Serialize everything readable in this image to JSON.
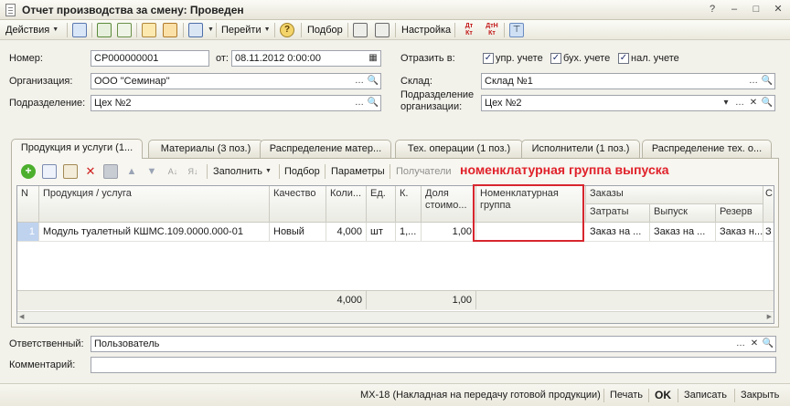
{
  "window": {
    "title": "Отчет производства за смену: Проведен"
  },
  "toolbar": {
    "actions": "Действия",
    "goto": "Перейти",
    "selection": "Подбор",
    "settings": "Настройка",
    "dt_kt": "Дт Кт",
    "dtn_kt": "ДтН Кт"
  },
  "form": {
    "number_label": "Номер:",
    "number": "СР000000001",
    "date_label": "от:",
    "date": "08.11.2012  0:00:00",
    "org_label": "Организация:",
    "org": "ООО \"Семинар\"",
    "dept_label": "Подразделение:",
    "dept": "Цех №2",
    "reflect_label": "Отразить в:",
    "check_mgmt": "упр. учете",
    "check_acc": "бух. учете",
    "check_tax": "нал. учете",
    "warehouse_label": "Склад:",
    "warehouse": "Склад №1",
    "org_dept_label_1": "Подразделение",
    "org_dept_label_2": "организации:",
    "org_dept": "Цех №2",
    "responsible_label": "Ответственный:",
    "responsible": "Пользователь",
    "comment_label": "Комментарий:",
    "comment": ""
  },
  "tabs": [
    "Продукция и услуги (1...",
    "Материалы (3 поз.)",
    "Распределение матер...",
    "Тех. операции (1 поз.)",
    "Исполнители (1 поз.)",
    "Распределение тех. о..."
  ],
  "panel_toolbar": {
    "fill": "Заполнить",
    "selection": "Подбор",
    "params": "Параметры",
    "recipients": "Получатели"
  },
  "annotation": "номенклатурная группа выпуска",
  "table": {
    "headers": {
      "n": "N",
      "product": "Продукция / услуга",
      "quality": "Качество",
      "qty": "Коли...",
      "unit": "Ед.",
      "k": "К.",
      "cost_share": "Доля стоимо...",
      "nom_group": "Номенклатурная группа",
      "orders": "Заказы",
      "costs": "Затраты",
      "output": "Выпуск",
      "reserve": "Резерв ...",
      "extra": "С"
    },
    "rows": [
      {
        "n": "1",
        "product": "Модуль туалетный  КШМС.109.0000.000-01",
        "quality": "Новый",
        "qty": "4,000",
        "unit": "шт",
        "k": "1,...",
        "cost_share": "1,00",
        "nom_group": "",
        "costs": "Заказ на ...",
        "output": "Заказ на ...",
        "reserve": "Заказ н...",
        "extra": "З"
      }
    ],
    "totals": {
      "qty": "4,000",
      "cost_share": "1,00"
    }
  },
  "bottom": {
    "form_name": "МХ-18 (Накладная на передачу готовой продукции)",
    "print": "Печать",
    "ok": "OK",
    "save": "Записать",
    "close": "Закрыть"
  }
}
